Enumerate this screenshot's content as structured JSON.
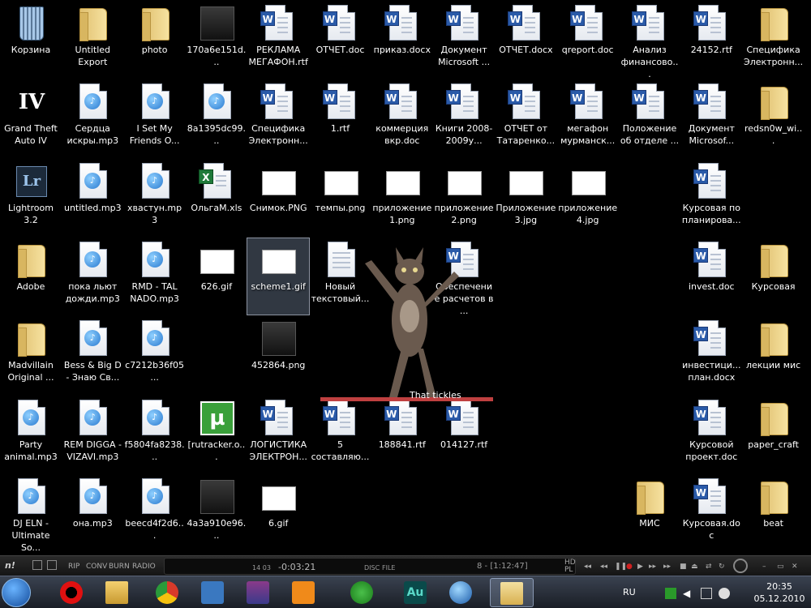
{
  "desktop": {
    "icons": [
      {
        "label": "Корзина",
        "kind": "bin"
      },
      {
        "label": "Untitled Export",
        "kind": "folder"
      },
      {
        "label": "photo",
        "kind": "folder"
      },
      {
        "label": "170a6e151d...",
        "kind": "thumb"
      },
      {
        "label": "РЕКЛАМА МЕГАФОН.rtf",
        "kind": "word"
      },
      {
        "label": "ОТЧЕТ.doc",
        "kind": "word"
      },
      {
        "label": "приказ.docx",
        "kind": "word"
      },
      {
        "label": "Документ Microsoft ...",
        "kind": "word"
      },
      {
        "label": "ОТЧЕТ.docx",
        "kind": "word"
      },
      {
        "label": "qreport.doc",
        "kind": "word"
      },
      {
        "label": "Анализ финансово...",
        "kind": "word"
      },
      {
        "label": "24152.rtf",
        "kind": "word"
      },
      {
        "label": "Спецификa Электронн...",
        "kind": "folder"
      },
      {
        "label": "Grand Theft Auto IV",
        "kind": "gta"
      },
      {
        "label": "Сердца искры.mp3",
        "kind": "mp3"
      },
      {
        "label": "I Set My Friends O...",
        "kind": "mp3"
      },
      {
        "label": "8a1395dc99...",
        "kind": "mp3"
      },
      {
        "label": "Спецификa Электронн...",
        "kind": "word"
      },
      {
        "label": "1.rtf",
        "kind": "word"
      },
      {
        "label": "коммерция вкр.doc",
        "kind": "word"
      },
      {
        "label": "Книги 2008-2009у...",
        "kind": "word"
      },
      {
        "label": "ОТЧЕТ от Татаренко...",
        "kind": "word"
      },
      {
        "label": "мегафон мурманск...",
        "kind": "word"
      },
      {
        "label": "Положение об отделе ...",
        "kind": "word"
      },
      {
        "label": "Документ Microsof...",
        "kind": "word"
      },
      {
        "label": "redsn0w_wi...",
        "kind": "folder"
      },
      {
        "label": "Lightroom 3.2",
        "kind": "lr"
      },
      {
        "label": "untitled.mp3",
        "kind": "mp3"
      },
      {
        "label": "хвастун.mp3",
        "kind": "mp3"
      },
      {
        "label": "ОльгаМ.xls",
        "kind": "excel"
      },
      {
        "label": "Снимок.PNG",
        "kind": "image"
      },
      {
        "label": "темпы.png",
        "kind": "image"
      },
      {
        "label": "приложение 1.png",
        "kind": "image"
      },
      {
        "label": "приложение 2.png",
        "kind": "image"
      },
      {
        "label": "Приложение 3.jpg",
        "kind": "image"
      },
      {
        "label": "приложение 4.jpg",
        "kind": "image"
      },
      {
        "label": "Курсовая по планирова...",
        "kind": "word"
      },
      {
        "label": "Adobe",
        "kind": "folder"
      },
      {
        "label": "пока льют дожди.mp3",
        "kind": "mp3"
      },
      {
        "label": "RMD - TAL NADO.mp3",
        "kind": "mp3"
      },
      {
        "label": "626.gif",
        "kind": "image"
      },
      {
        "label": "scheme1.gif",
        "kind": "image",
        "selected": true
      },
      {
        "label": "Новый текстовый...",
        "kind": "text"
      },
      {
        "label": "Обеспечение расчетов в ...",
        "kind": "word"
      },
      {
        "label": "invest.doc",
        "kind": "word"
      },
      {
        "label": "Курсовая",
        "kind": "folder"
      },
      {
        "label": "Madvillain Original ...",
        "kind": "folder"
      },
      {
        "label": "Bess & Big D - Знаю Св...",
        "kind": "mp3"
      },
      {
        "label": "c7212b36f05...",
        "kind": "mp3"
      },
      {
        "label": "452864.png",
        "kind": "thumb"
      },
      {
        "label": "инвестици... план.docx",
        "kind": "word"
      },
      {
        "label": "лекции мис",
        "kind": "folder"
      },
      {
        "label": "Party animal.mp3",
        "kind": "mp3"
      },
      {
        "label": "REM DIGGA - VIZAVI.mp3",
        "kind": "mp3"
      },
      {
        "label": "f5804fa8238...",
        "kind": "mp3"
      },
      {
        "label": "[rutracker.o...",
        "kind": "utorrent"
      },
      {
        "label": "ЛОГИСТИКА ЭЛЕКТРОН...",
        "kind": "word"
      },
      {
        "label": "5 составляю...",
        "kind": "word"
      },
      {
        "label": "188841.rtf",
        "kind": "word"
      },
      {
        "label": "014127.rtf",
        "kind": "word"
      },
      {
        "label": "Курсовой проект.doc",
        "kind": "word"
      },
      {
        "label": "paper_craft",
        "kind": "folder"
      },
      {
        "label": "DJ ELN - Ultimate So...",
        "kind": "mp3"
      },
      {
        "label": "она.mp3",
        "kind": "mp3"
      },
      {
        "label": "beecd4f2d6...",
        "kind": "mp3"
      },
      {
        "label": "4a3a910e96...",
        "kind": "thumb"
      },
      {
        "label": "6.gif",
        "kind": "image"
      },
      {
        "label": "МИС",
        "kind": "folder"
      },
      {
        "label": "Курсовая.doc",
        "kind": "word"
      },
      {
        "label": "beat",
        "kind": "folder"
      }
    ],
    "gadget_caption": "That tickles"
  },
  "player": {
    "left_labels": [
      "RIP",
      "CONV",
      "BURN",
      "RADIO"
    ],
    "track_pos": "14 03",
    "time": "-0:03:21",
    "disc_label": "DISC",
    "file_label": "FILE",
    "time_total": "8 - [1:12:47]",
    "side_labels": [
      "HD",
      "PL"
    ]
  },
  "tray": {
    "language": "RU",
    "time": "20:35",
    "date": "05.12.2010"
  },
  "taskbar": {
    "apps": [
      "start",
      "opera",
      "explorer",
      "chrome",
      "totalcmd",
      "winrar",
      "flstudio",
      "messenger",
      "audition",
      "itunes",
      "folder-active"
    ]
  }
}
